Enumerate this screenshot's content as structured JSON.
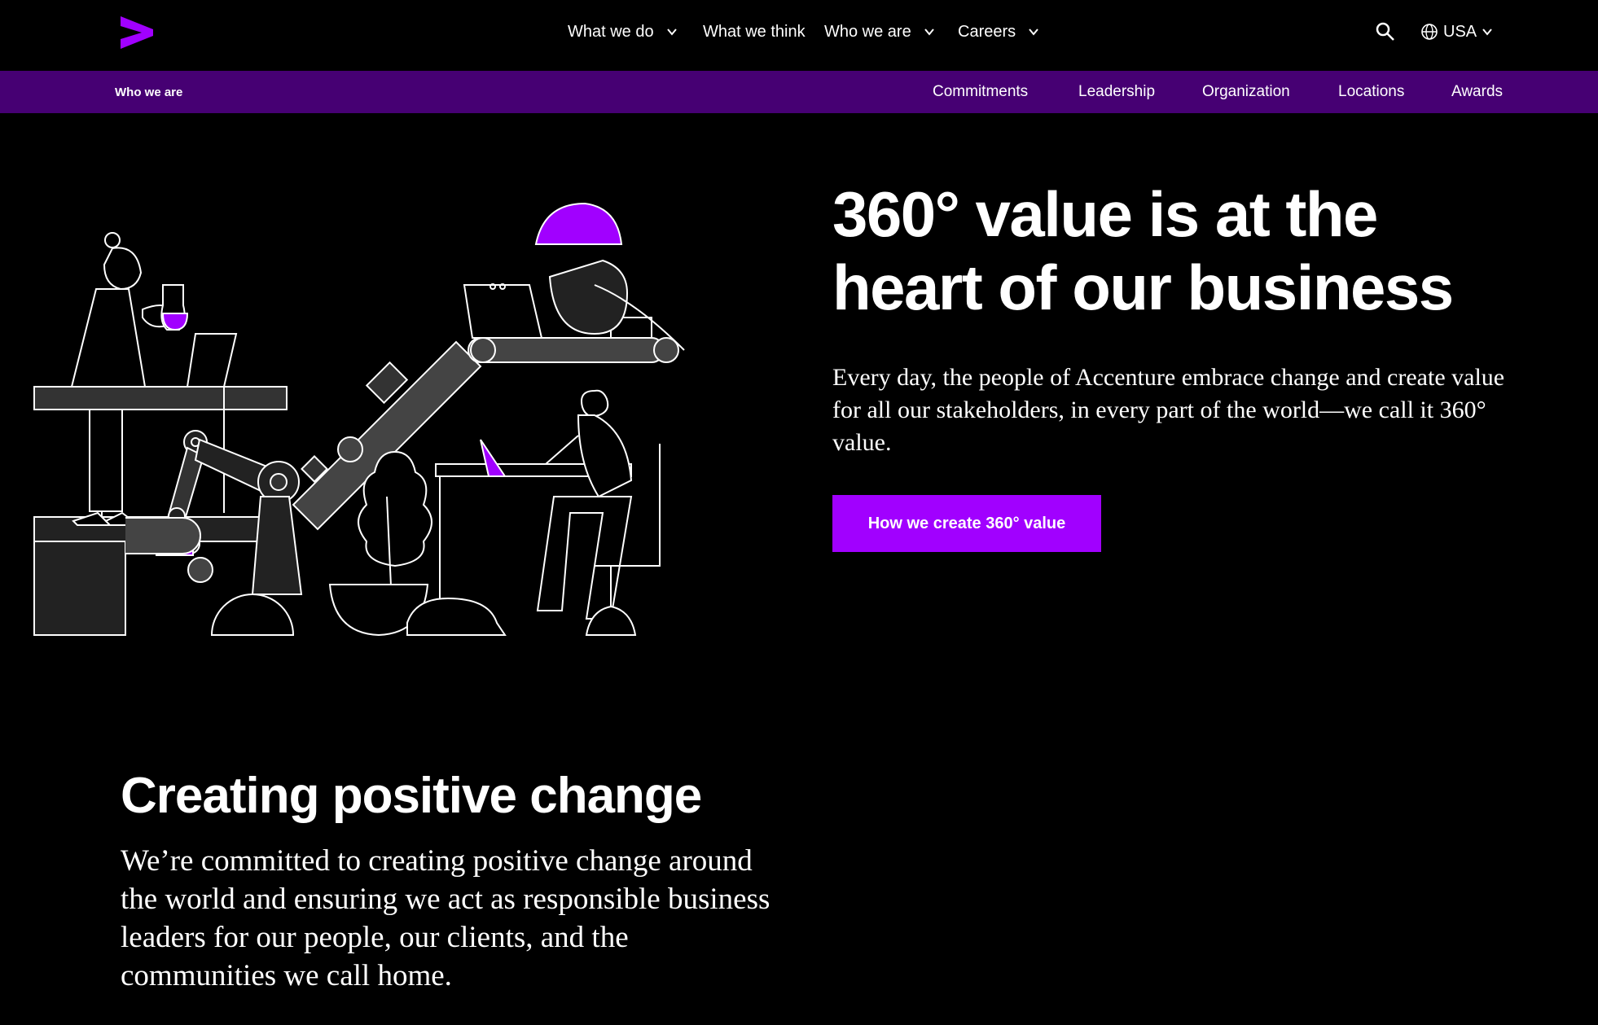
{
  "brand": {
    "logo_icon": "accenture-greater-than-logo",
    "accent": "#a100ff",
    "subnav_bg": "#460073"
  },
  "topnav": {
    "items": [
      {
        "label": "What we do",
        "has_dropdown": true
      },
      {
        "label": "What we think",
        "has_dropdown": false
      },
      {
        "label": "Who we are",
        "has_dropdown": true
      },
      {
        "label": "Careers",
        "has_dropdown": true
      }
    ],
    "search_icon": "search-icon",
    "locale": {
      "label": "USA",
      "icon": "globe-icon"
    }
  },
  "subnav": {
    "title": "Who we are",
    "links": [
      "Commitments",
      "Leadership",
      "Organization",
      "Locations",
      "Awards"
    ]
  },
  "hero": {
    "title_line1": "360° value is at the",
    "title_line2": "heart of our business",
    "text": "Every day, the people of Accenture embrace change and create value for all our stakeholders, in every part of the world—we call it 360° value.",
    "cta_label": "How we create 360° value"
  },
  "section": {
    "title": "Creating positive change",
    "text": "We’re committed to creating positive change around the world and ensuring we act as responsible business leaders for our people, our clients, and the communities we call home."
  }
}
